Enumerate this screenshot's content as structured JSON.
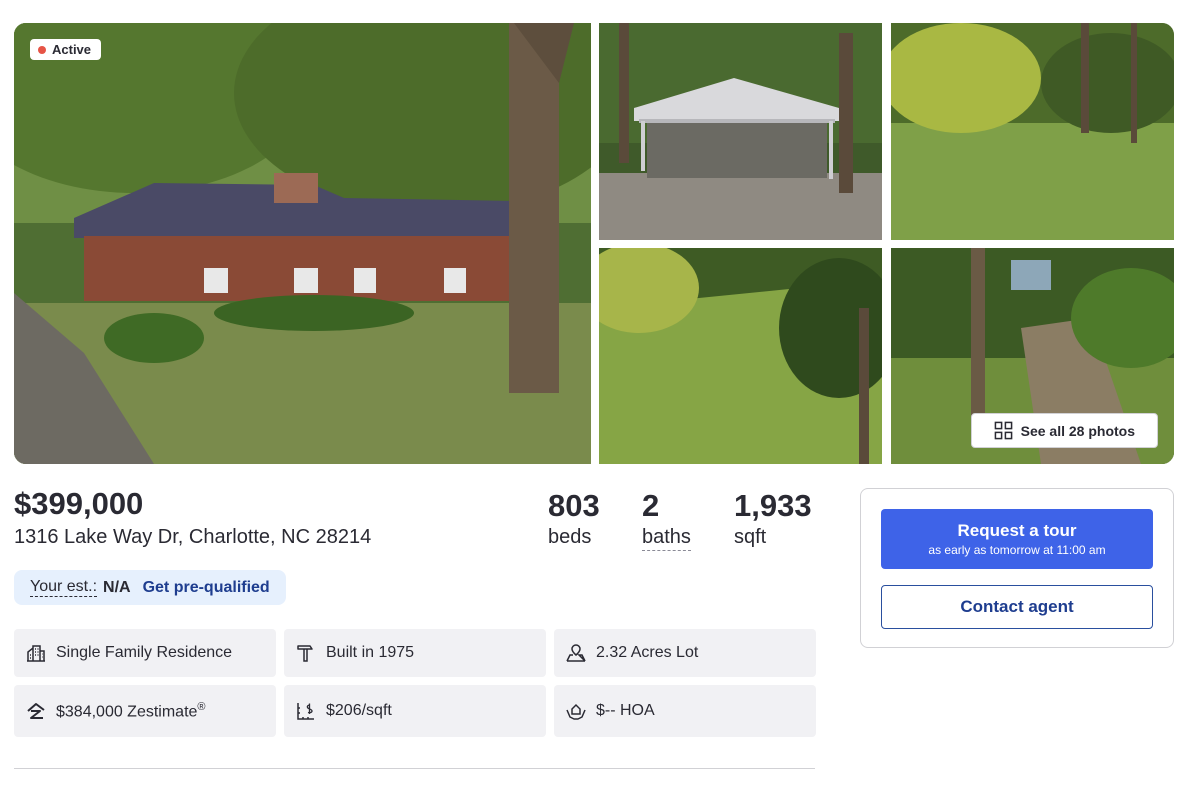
{
  "listing": {
    "status": "Active",
    "price": "$399,000",
    "address": "1316 Lake Way Dr, Charlotte, NC 28214",
    "stats": [
      {
        "value": "803",
        "label": "beds"
      },
      {
        "value": "2",
        "label": "baths"
      },
      {
        "value": "1,933",
        "label": "sqft"
      }
    ]
  },
  "gallery": {
    "see_all_label": "See all 28 photos",
    "status_color": "#e65446"
  },
  "estimate": {
    "label": "Your est.:",
    "value": "N/A",
    "link": "Get pre-qualified"
  },
  "facts": [
    {
      "icon": "building-icon",
      "text": "Single Family Residence"
    },
    {
      "icon": "hammer-icon",
      "text": "Built in 1975"
    },
    {
      "icon": "lot-icon",
      "text": "2.32 Acres Lot"
    },
    {
      "icon": "zestimate-icon",
      "text": "$384,000 Zestimate",
      "sup": "®"
    },
    {
      "icon": "price-per-sqft-icon",
      "text": "$206/sqft"
    },
    {
      "icon": "hoa-icon",
      "text": "$-- HOA"
    }
  ],
  "cta": {
    "tour_label": "Request a tour",
    "tour_sub": "as early as tomorrow at 11:00 am",
    "contact_label": "Contact agent",
    "accent_color": "#3e63e8"
  }
}
